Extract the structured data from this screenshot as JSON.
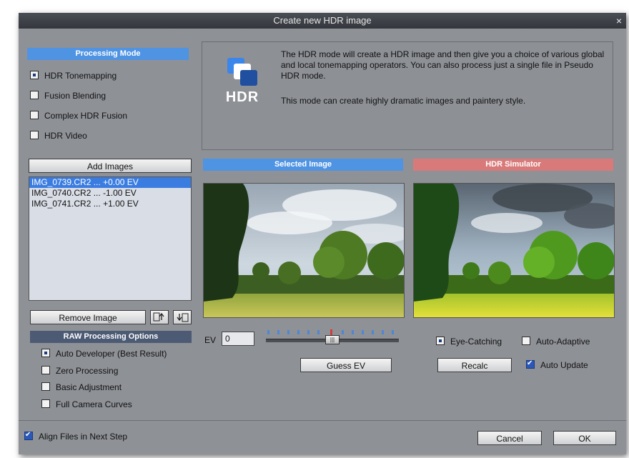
{
  "window": {
    "title": "Create new HDR image",
    "close_label": "×"
  },
  "processing_mode": {
    "header": "Processing  Mode",
    "options": [
      {
        "label": "HDR Tonemapping",
        "selected": true
      },
      {
        "label": "Fusion Blending",
        "selected": false
      },
      {
        "label": "Complex HDR Fusion",
        "selected": false
      },
      {
        "label": "HDR Video",
        "selected": false
      }
    ]
  },
  "info": {
    "icon_label": "HDR",
    "text1": "The HDR mode will create a HDR image and then give you a choice of various global and local tonemapping operators. You can also process just a single file in Pseudo HDR mode.",
    "text2": "This mode can create highly dramatic images and paintery style."
  },
  "images": {
    "add_label": "Add Images",
    "items": [
      {
        "name": "IMG_0739.CR2 ...",
        "ev": "+0.00 EV",
        "selected": true
      },
      {
        "name": "IMG_0740.CR2 ...",
        "ev": "-1.00 EV",
        "selected": false
      },
      {
        "name": "IMG_0741.CR2 ...",
        "ev": "+1.00 EV",
        "selected": false
      }
    ],
    "remove_label": "Remove Image"
  },
  "raw": {
    "header": "RAW Processing Options",
    "options": [
      {
        "label": "Auto Developer (Best Result)",
        "selected": true
      },
      {
        "label": "Zero Processing",
        "selected": false
      },
      {
        "label": "Basic Adjustment",
        "selected": false
      },
      {
        "label": "Full Camera Curves",
        "selected": false
      }
    ]
  },
  "selected_image": {
    "header": "Selected Image"
  },
  "hdr_simulator": {
    "header": "HDR Simulator"
  },
  "ev": {
    "label": "EV",
    "value": "0",
    "slider_level": 0.5,
    "guess_label": "Guess EV"
  },
  "simulator_controls": {
    "eye_catching": "Eye-Catching",
    "auto_adaptive": "Auto-Adaptive",
    "recalc": "Recalc",
    "auto_update": "Auto Update"
  },
  "footer": {
    "align_label": "Align Files in Next Step",
    "cancel": "Cancel",
    "ok": "OK"
  },
  "colors": {
    "blue_header": "#4f93e3",
    "red_header": "#d97a7a",
    "dialog_bg": "#8e9196"
  }
}
